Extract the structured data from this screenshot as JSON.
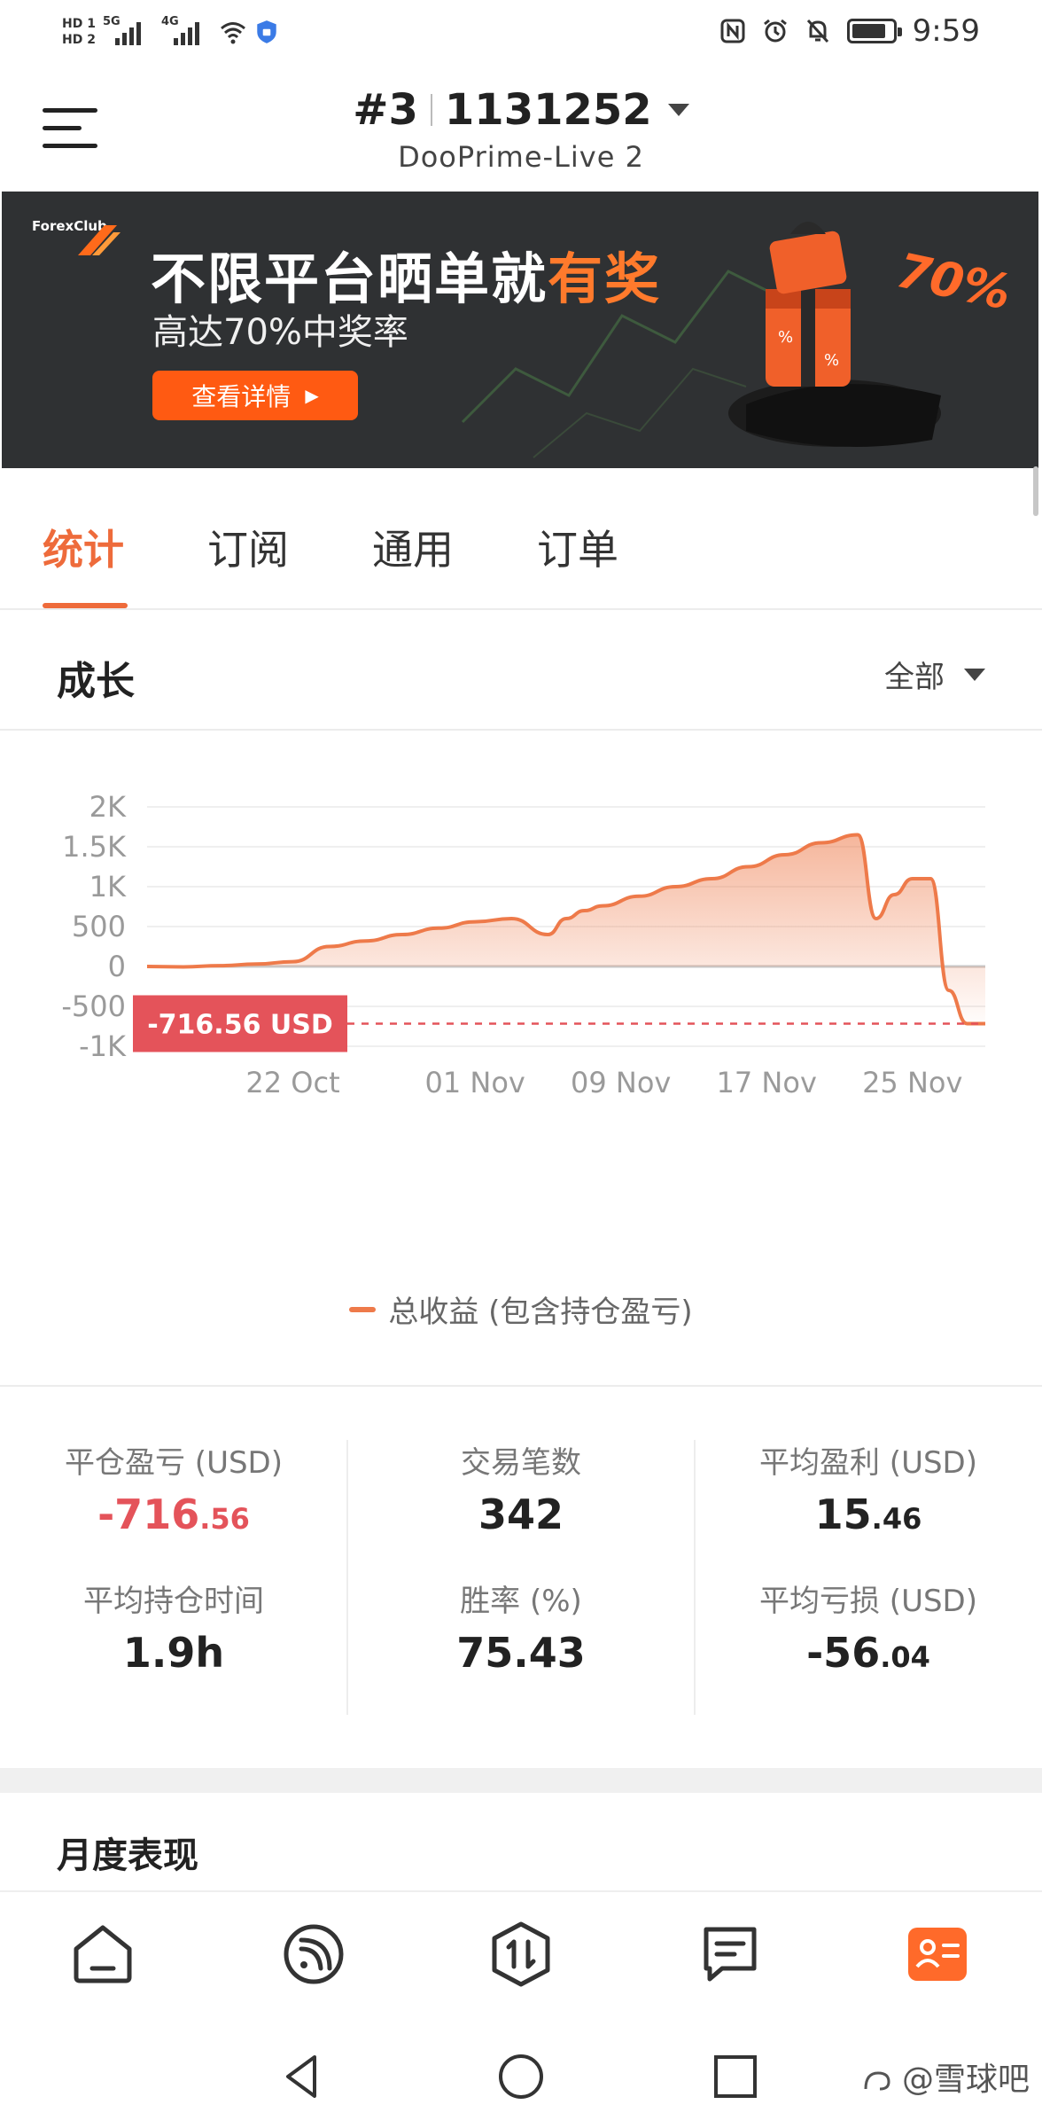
{
  "status_bar": {
    "hd1": "HD 1",
    "hd2": "HD 2",
    "sim1_tag": "5G",
    "sim2_tag": "4G",
    "time": "9:59",
    "battery_level": 0.85
  },
  "header": {
    "account_prefix": "#3",
    "account_number": "1131252",
    "server": "DooPrime-Live 2"
  },
  "banner": {
    "brand": "ForexClub",
    "title_main": "不限平台晒单就",
    "title_highlight": "有奖",
    "subtitle": "高达70%中奖率",
    "button_label": "查看详情",
    "badge": "70%",
    "accent_color": "#ff5a12"
  },
  "tabs": [
    {
      "label": "统计",
      "active": true
    },
    {
      "label": "订阅",
      "active": false
    },
    {
      "label": "通用",
      "active": false
    },
    {
      "label": "订单",
      "active": false
    }
  ],
  "growth": {
    "title": "成长",
    "filter": "全部"
  },
  "chart_data": {
    "type": "area",
    "y_ticks": [
      "2K",
      "1.5K",
      "1K",
      "500",
      "0",
      "-500",
      "-1K"
    ],
    "ylim": [
      -1000,
      2000
    ],
    "x_ticks": [
      "22 Oct",
      "01 Nov",
      "09 Nov",
      "17 Nov",
      "25 Nov"
    ],
    "x": [
      "14 Oct",
      "16 Oct",
      "18 Oct",
      "20 Oct",
      "22 Oct",
      "24 Oct",
      "26 Oct",
      "28 Oct",
      "30 Oct",
      "01 Nov",
      "03 Nov",
      "05 Nov",
      "06 Nov",
      "07 Nov",
      "08 Nov",
      "10 Nov",
      "12 Nov",
      "14 Nov",
      "16 Nov",
      "18 Nov",
      "20 Nov",
      "22 Nov",
      "23 Nov",
      "24 Nov",
      "25 Nov",
      "26 Nov",
      "27 Nov",
      "28 Nov",
      "29 Nov"
    ],
    "series": [
      {
        "name": "总收益 (包含持仓盈亏)",
        "color": "#ee7a4a",
        "values": [
          0,
          -5,
          10,
          30,
          60,
          250,
          320,
          400,
          480,
          560,
          600,
          400,
          600,
          700,
          760,
          880,
          1000,
          1100,
          1250,
          1400,
          1550,
          1650,
          600,
          900,
          1100,
          1100,
          -300,
          -716.56,
          -716.56
        ]
      }
    ],
    "marker": {
      "value": -716.56,
      "label": "-716.56 USD",
      "color": "#e4535a"
    },
    "legend": "总收益 (包含持仓盈亏)",
    "grid": true
  },
  "stats": [
    {
      "label": "平仓盈亏 (USD)",
      "int": "-716",
      "dec": ".56",
      "negative": true
    },
    {
      "label": "交易笔数",
      "int": "342",
      "dec": "",
      "negative": false
    },
    {
      "label": "平均盈利 (USD)",
      "int": "15",
      "dec": ".46",
      "negative": false
    },
    {
      "label": "平均持仓时间",
      "int": "1.9h",
      "dec": "",
      "negative": false
    },
    {
      "label": "胜率 (%)",
      "int": "75.43",
      "dec": "",
      "negative": false
    },
    {
      "label": "平均亏损 (USD)",
      "int": "-56",
      "dec": ".04",
      "negative": false
    }
  ],
  "monthly": {
    "title": "月度表现"
  },
  "bottom_nav": [
    {
      "icon": "home-icon",
      "active": false
    },
    {
      "icon": "feed-icon",
      "active": false
    },
    {
      "icon": "trade-icon",
      "active": false
    },
    {
      "icon": "messages-icon",
      "active": false
    },
    {
      "icon": "profile-card-icon",
      "active": true
    }
  ],
  "system_nav": {
    "watermark": "@雪球吧"
  }
}
